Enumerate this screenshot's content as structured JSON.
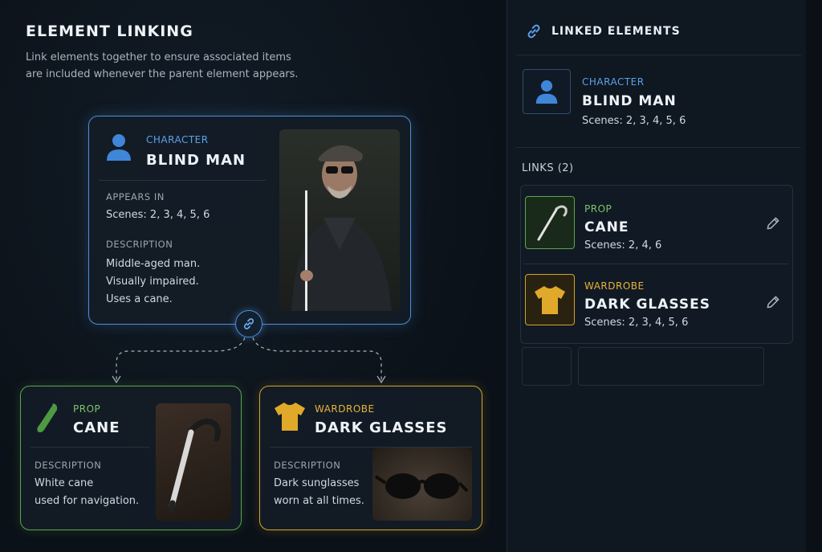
{
  "header": {
    "title": "ELEMENT LINKING",
    "subtitle_line1": "Link elements together to ensure associated items",
    "subtitle_line2": "are included whenever the parent element appears."
  },
  "parent": {
    "type": "CHARACTER",
    "name": "BLIND MAN",
    "appears_label": "APPEARS IN",
    "scenes": "Scenes: 2, 3, 4, 5, 6",
    "description_label": "DESCRIPTION",
    "description_lines": [
      "Middle-aged man.",
      "Visually impaired.",
      "Uses a cane."
    ],
    "icon": "person-icon",
    "color": "#4d8fd8"
  },
  "children": [
    {
      "type": "PROP",
      "name": "CANE",
      "description_label": "DESCRIPTION",
      "description_lines": [
        "White cane",
        "used for navigation."
      ],
      "icon": "cane-icon",
      "color": "#5aa64c"
    },
    {
      "type": "WARDROBE",
      "name": "DARK GLASSES",
      "description_label": "DESCRIPTION",
      "description_lines": [
        "Dark sunglasses",
        "worn at all times."
      ],
      "icon": "shirt-icon",
      "color": "#d4a22a"
    }
  ],
  "panel": {
    "title": "LINKED ELEMENTS",
    "selected": {
      "type": "CHARACTER",
      "name": "BLIND MAN",
      "scenes": "Scenes: 2, 3, 4, 5, 6"
    },
    "links_label": "LINKS (2)",
    "links": [
      {
        "type": "PROP",
        "name": "CANE",
        "scenes": "Scenes: 2, 4, 6"
      },
      {
        "type": "WARDROBE",
        "name": "DARK GLASSES",
        "scenes": "Scenes: 2, 3, 4, 5, 6"
      }
    ]
  }
}
